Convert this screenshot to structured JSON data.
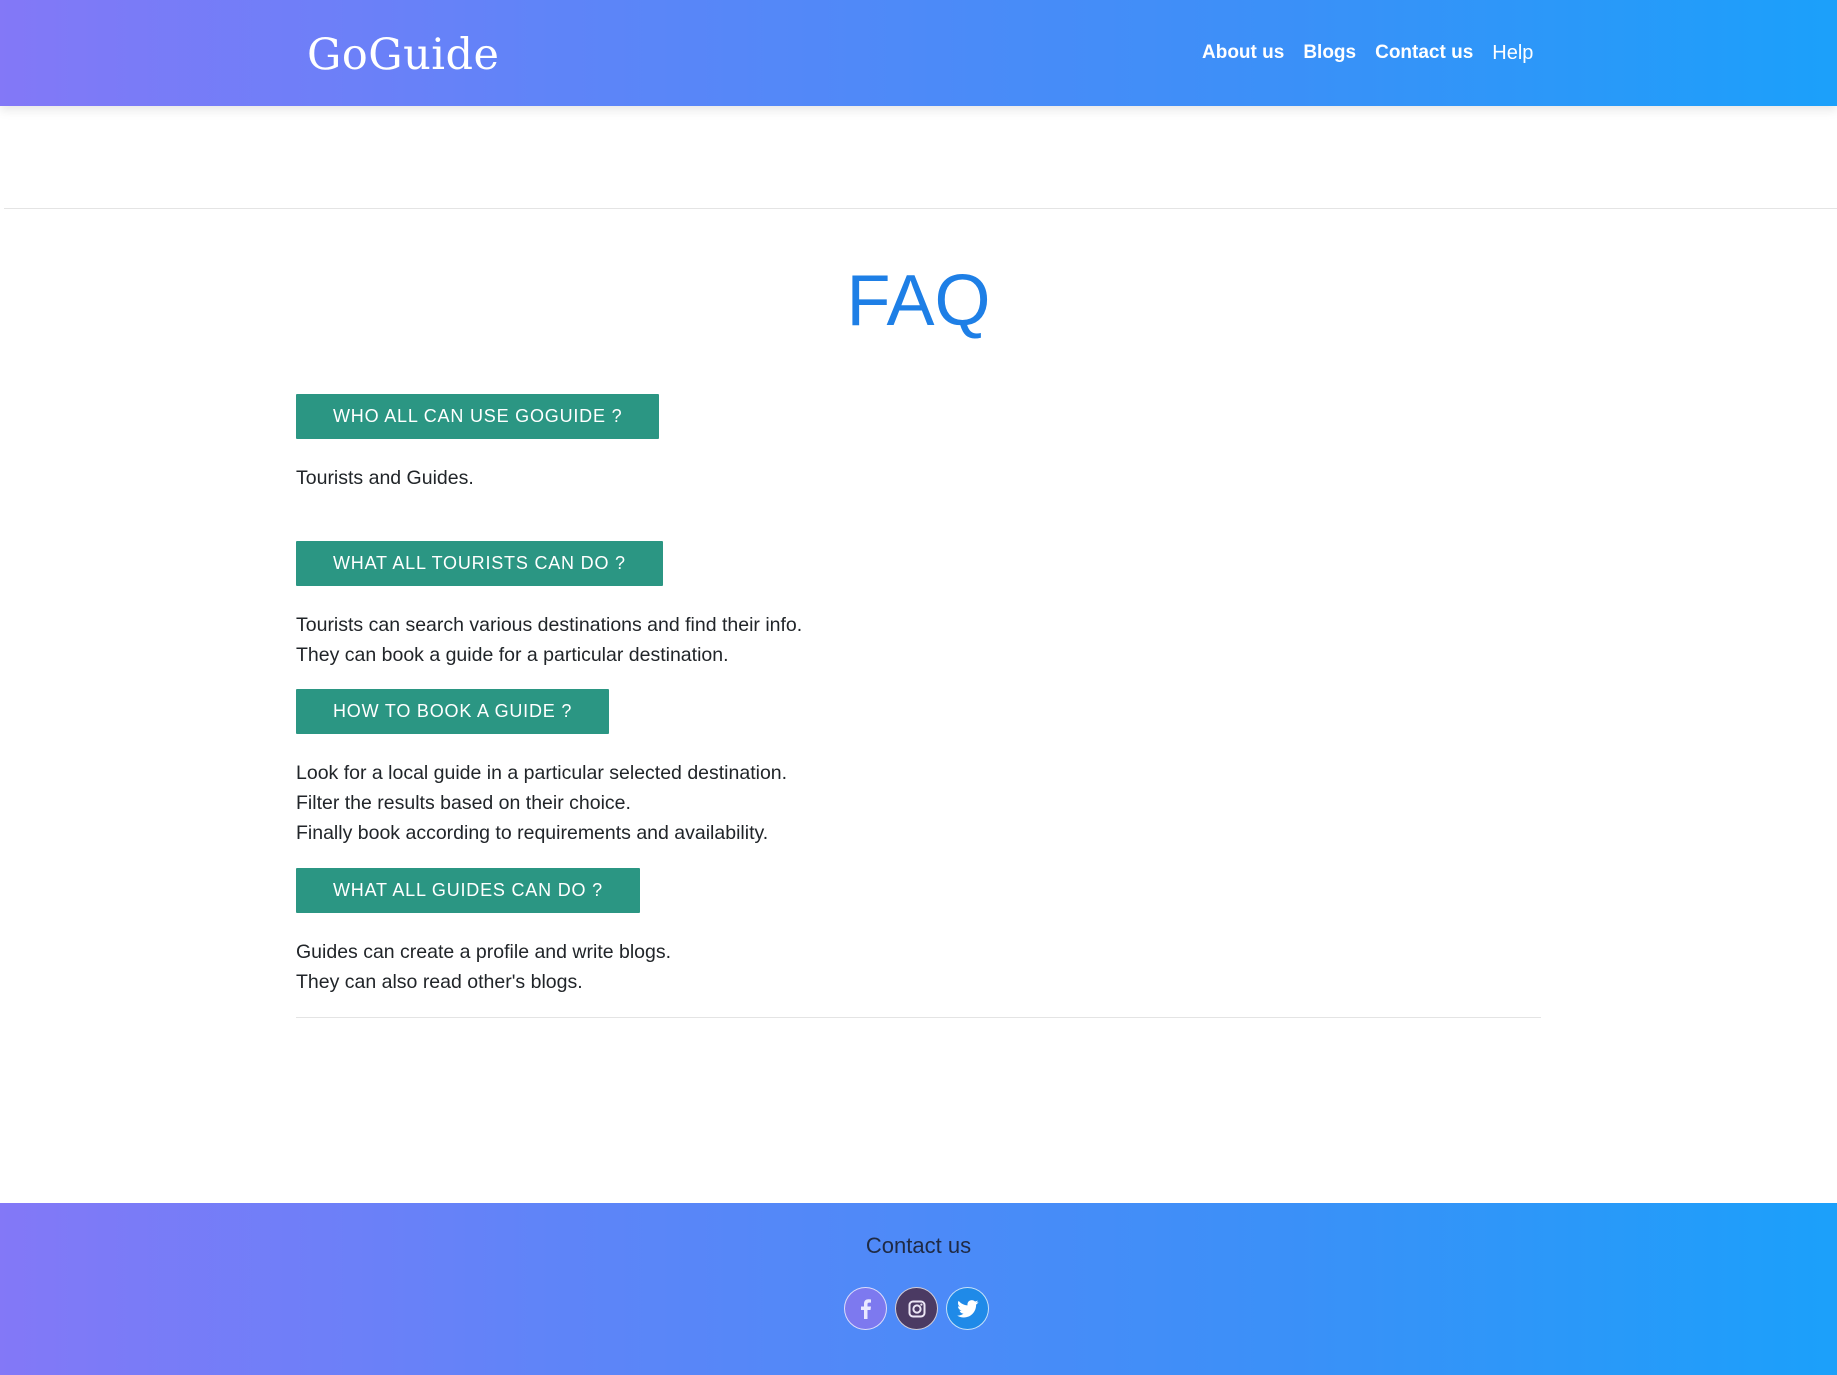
{
  "header": {
    "brand": "GoGuide",
    "nav": [
      {
        "label": "About us"
      },
      {
        "label": "Blogs"
      },
      {
        "label": "Contact us"
      },
      {
        "label": "Help"
      }
    ]
  },
  "main": {
    "title": "FAQ",
    "faqs": [
      {
        "question": "WHO ALL CAN USE GOGUIDE ?",
        "answer": [
          "Tourists and Guides."
        ]
      },
      {
        "question": "WHAT ALL TOURISTS CAN DO ?",
        "answer": [
          "Tourists can search various destinations and find their info.",
          "They can book a guide for a particular destination."
        ]
      },
      {
        "question": "HOW TO BOOK A GUIDE ?",
        "answer": [
          "Look for a local guide in a particular selected destination.",
          "Filter the results based on their choice.",
          "Finally book according to requirements and availability."
        ]
      },
      {
        "question": "WHAT ALL GUIDES CAN DO ?",
        "answer": [
          "Guides can create a profile and write blogs.",
          "They can also read other's blogs."
        ]
      }
    ]
  },
  "footer": {
    "title": "Contact us",
    "socials": [
      {
        "icon": "facebook-icon",
        "color": "#7d79ef"
      },
      {
        "icon": "instagram-icon",
        "color": "#4b3a63"
      },
      {
        "icon": "twitter-icon",
        "color": "#1f8ae8"
      }
    ]
  },
  "colors": {
    "gradient_start": "#8378f7",
    "gradient_end": "#1ba0fa",
    "title_blue": "#1e7fe6",
    "button_teal": "#2b9683"
  }
}
